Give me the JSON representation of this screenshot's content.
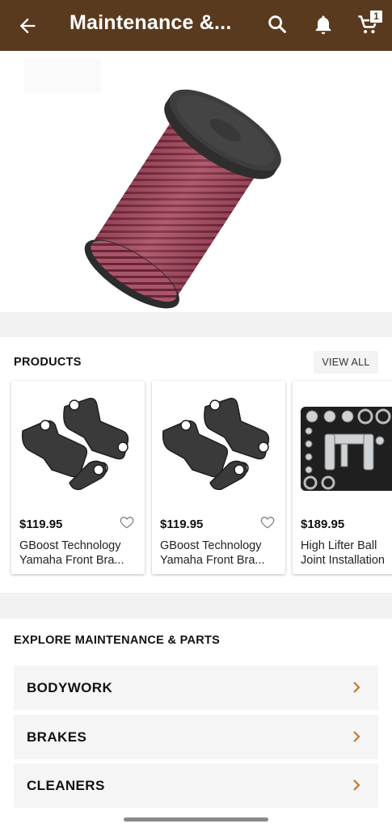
{
  "app_bar": {
    "title": "Maintenance &...",
    "cart_count": "1",
    "colors": {
      "background": "#5a3a1e",
      "foreground": "#ffffff"
    },
    "icons": [
      "back-arrow-icon",
      "search-icon",
      "bell-icon",
      "cart-icon"
    ]
  },
  "hero": {
    "image": "air-filter"
  },
  "products": {
    "title": "PRODUCTS",
    "view_all": "VIEW ALL",
    "items": [
      {
        "price": "$119.95",
        "name_line1": "GBoost Technology",
        "name_line2": "Yamaha Front Bra...",
        "image": "brake-pads"
      },
      {
        "price": "$119.95",
        "name_line1": "GBoost Technology",
        "name_line2": "Yamaha Front Bra...",
        "image": "brake-pads"
      },
      {
        "price": "$189.95",
        "name_line1": "High Lifter Ball",
        "name_line2": "Joint Installation",
        "image": "ball-joint-tool-kit"
      }
    ]
  },
  "explore": {
    "title": "EXPLORE MAINTENANCE & PARTS",
    "chevron_color": "#c7762a",
    "categories": [
      {
        "label": "BODYWORK"
      },
      {
        "label": "BRAKES"
      },
      {
        "label": "CLEANERS"
      }
    ]
  }
}
